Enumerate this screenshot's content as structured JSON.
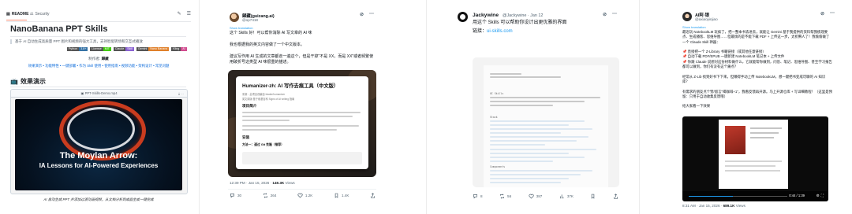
{
  "readme": {
    "tab_readme": "README",
    "tab_security": "Security",
    "title": "NanoBanana PPT Skills",
    "quote": "基于 AI 自动生成高质量 PPT 图片和视频的强大工具，支持智能转场和交互式播放",
    "badges": [
      {
        "k": "Python",
        "v": "3.8+",
        "color": "#3572a5"
      },
      {
        "k": "License",
        "v": "MIT",
        "color": "#44cc11"
      },
      {
        "k": "Claude",
        "v": "Skill",
        "color": "#8a63d2"
      },
      {
        "k": "Gemini",
        "v": "Nano Banana",
        "color": "#e0802a"
      },
      {
        "k": "Kling",
        "v": "AI",
        "color": "#d14b8f"
      }
    ],
    "author_label": "制作者",
    "author_name": "歸藏",
    "links": "效果演示 • 功能特性 • 一键部署 • 作为 Skill 使用 • 使用指南 • 视频功能 • 架构设计 • 常见问题",
    "h2": "效果演示",
    "pdf_name": "PPT-Skills-Demo.mp4",
    "slide_title1": "The Moylan Arrow:",
    "slide_title2": "IA Lessons for AI-Powered Experiences",
    "caption": "AI 自动生成 PPT 并添加过渡动画视频，从文档分析到成品生成一键完成"
  },
  "tweet2": {
    "name": "歸藏(guizang.ai)",
    "handle": "@op7418",
    "show_translation": "Show translation",
    "text": "这个 Skills 好！可以帮你消除 AI 写文章的 AI 味\n\n我也根据我的英文内容做了一个中文版本。\n\n建议写作用 AI 生成的文章都走一遍这个，但是干掉\"不是 XX，而是 XX\"或者频繁使用破折号这类型 AI 味很重的描述。",
    "card_title": "Humanizer-zh: AI 写作去痕工具（中文版）",
    "card_small1": "来源：此项目改编自 blader/humanizer",
    "card_small2": "英文原版 基于维基百科 Signs of AI writing 指南",
    "card_h1": "项目简介",
    "card_h2": "安装",
    "card_h3": "方法一：通过 Git 克隆（推荐）",
    "time": "12:39 PM · Jan 15, 2026 · ",
    "views": "149.3K",
    "views_label": "Views",
    "actions": {
      "reply": "30",
      "retweet": "264",
      "like": "1.2K",
      "bookmark": "1.4K"
    }
  },
  "tweet3": {
    "name": "Jackywine",
    "handle": "@Jackywine · Jan 12",
    "text": "用这个 Skills 可以帮助你设计出更优雅的界面",
    "link_label": "链接：",
    "link": "ui-skills.com",
    "actions": {
      "reply": "8",
      "retweet": "56",
      "like": "387",
      "views": "37K"
    }
  },
  "tweet4": {
    "name": "AI阿·银",
    "handle": "@axiaoyinjiao",
    "show_translation": "Show translation",
    "text": "最近玩 NotebookLM 玩疯了，把一整本书丢进去，就能让 Gemini 基于我提供的资料帮我梳理要点、生成播客、思维导图……但最烦的是不能下载 PDF + 上传这一步，太折腾人了！我偷偷做了一个 Claude Skill 神器：\n\n📌 直接把一个 Z-Library 书籍链接（或其他任意链接）\n📌 自动下载 PDF/EPUB 一键新建 NotebookLM 笔记本 + 上传文件\n📌 你跟 Claude 说想对这份材料做什么，它就能帮你做到，问答、笔记、思维导图、甚至学习报告都可以做到，你们有没有这个痛点？\n\n经常从 Z-Lib 找到好书下下来，但懒得手动上传 NotebookLM，想一键把书变成可聊的 AI 知识库？\n\n有需求的朋友点个赞/留言\"喝咖啡+1\"，我看反馈再开源。马上开源仓库 + 写详细教程！（这里是预留：只用于自动收集反馈哦）\n\n给大家看一下效果",
    "video_time": "0:44 / 1:39",
    "time": "8:31 AM · Jan 15, 2026 · ",
    "views": "689.1K",
    "views_label": "Views"
  }
}
